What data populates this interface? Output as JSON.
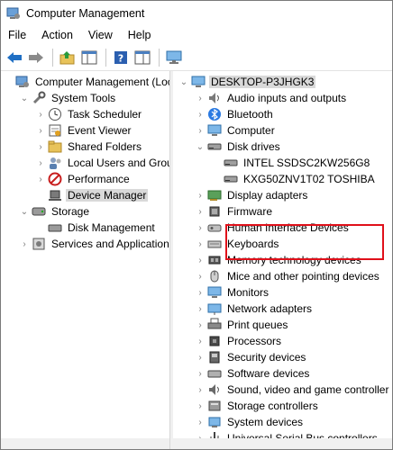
{
  "window": {
    "title": "Computer Management"
  },
  "menu": [
    "File",
    "Action",
    "View",
    "Help"
  ],
  "toolbar_icons": [
    "back-arrow-icon",
    "forward-arrow-icon",
    "up-folder-icon",
    "show-hide-tree-icon",
    "help-icon",
    "properties-icon",
    "monitor-icon"
  ],
  "left_tree": [
    {
      "label": "Computer Management (Local",
      "icon": "computer-management-icon",
      "chev": "",
      "indent": 0
    },
    {
      "label": "System Tools",
      "icon": "tools-icon",
      "chev": "⌄",
      "indent": 1
    },
    {
      "label": "Task Scheduler",
      "icon": "clock-icon",
      "chev": "›",
      "indent": 2
    },
    {
      "label": "Event Viewer",
      "icon": "event-viewer-icon",
      "chev": "›",
      "indent": 2
    },
    {
      "label": "Shared Folders",
      "icon": "folder-icon",
      "chev": "›",
      "indent": 2
    },
    {
      "label": "Local Users and Groups",
      "icon": "users-icon",
      "chev": "›",
      "indent": 2
    },
    {
      "label": "Performance",
      "icon": "performance-icon",
      "chev": "›",
      "indent": 2
    },
    {
      "label": "Device Manager",
      "icon": "device-manager-icon",
      "chev": "",
      "indent": 2,
      "selected": true
    },
    {
      "label": "Storage",
      "icon": "storage-icon",
      "chev": "⌄",
      "indent": 1
    },
    {
      "label": "Disk Management",
      "icon": "disk-icon",
      "chev": "",
      "indent": 2
    },
    {
      "label": "Services and Applications",
      "icon": "services-icon",
      "chev": "›",
      "indent": 1
    }
  ],
  "right_tree": [
    {
      "label": "DESKTOP-P3JHGK3",
      "icon": "computer-icon",
      "chev": "⌄",
      "indent": 0,
      "selected": true
    },
    {
      "label": "Audio inputs and outputs",
      "icon": "speaker-icon",
      "chev": "›",
      "indent": 1
    },
    {
      "label": "Bluetooth",
      "icon": "bluetooth-icon",
      "chev": "›",
      "indent": 1
    },
    {
      "label": "Computer",
      "icon": "monitor-icon",
      "chev": "›",
      "indent": 1
    },
    {
      "label": "Disk drives",
      "icon": "disk-drive-icon",
      "chev": "⌄",
      "indent": 1
    },
    {
      "label": "INTEL SSDSC2KW256G8",
      "icon": "disk-drive-icon",
      "chev": "",
      "indent": 2
    },
    {
      "label": "KXG50ZNV1T02 TOSHIBA",
      "icon": "disk-drive-icon",
      "chev": "",
      "indent": 2
    },
    {
      "label": "Display adapters",
      "icon": "display-adapter-icon",
      "chev": "›",
      "indent": 1
    },
    {
      "label": "Firmware",
      "icon": "firmware-icon",
      "chev": "›",
      "indent": 1
    },
    {
      "label": "Human Interface Devices",
      "icon": "hid-icon",
      "chev": "›",
      "indent": 1
    },
    {
      "label": "Keyboards",
      "icon": "keyboard-icon",
      "chev": "›",
      "indent": 1
    },
    {
      "label": "Memory technology devices",
      "icon": "memory-icon",
      "chev": "›",
      "indent": 1
    },
    {
      "label": "Mice and other pointing devices",
      "icon": "mouse-icon",
      "chev": "›",
      "indent": 1
    },
    {
      "label": "Monitors",
      "icon": "monitor-icon",
      "chev": "›",
      "indent": 1
    },
    {
      "label": "Network adapters",
      "icon": "network-icon",
      "chev": "›",
      "indent": 1
    },
    {
      "label": "Print queues",
      "icon": "printer-icon",
      "chev": "›",
      "indent": 1
    },
    {
      "label": "Processors",
      "icon": "processor-icon",
      "chev": "›",
      "indent": 1
    },
    {
      "label": "Security devices",
      "icon": "security-icon",
      "chev": "›",
      "indent": 1
    },
    {
      "label": "Software devices",
      "icon": "software-device-icon",
      "chev": "›",
      "indent": 1
    },
    {
      "label": "Sound, video and game controller",
      "icon": "sound-icon",
      "chev": "›",
      "indent": 1
    },
    {
      "label": "Storage controllers",
      "icon": "storage-controller-icon",
      "chev": "›",
      "indent": 1
    },
    {
      "label": "System devices",
      "icon": "system-device-icon",
      "chev": "›",
      "indent": 1
    },
    {
      "label": "Universal Serial Bus controllers",
      "icon": "usb-icon",
      "chev": "›",
      "indent": 1
    }
  ],
  "colors": {
    "highlight_border": "#e0101a",
    "selection": "#d9d9d9"
  }
}
